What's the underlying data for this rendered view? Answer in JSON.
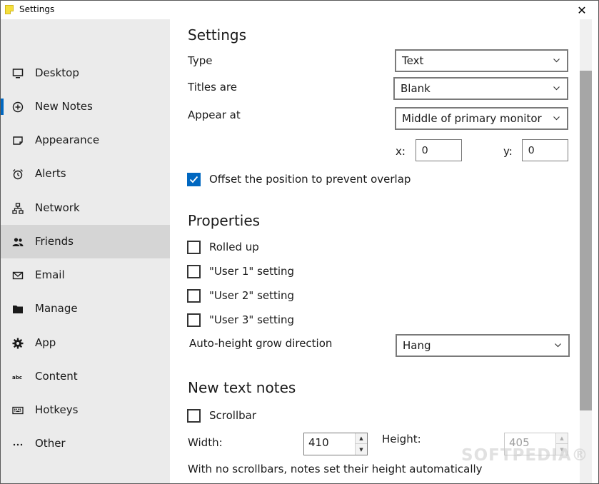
{
  "window": {
    "title": "Settings",
    "close_glyph": "✕"
  },
  "sidebar": {
    "items": [
      {
        "label": "Desktop",
        "icon": "monitor-icon"
      },
      {
        "label": "New Notes",
        "icon": "plus-circle-icon"
      },
      {
        "label": "Appearance",
        "icon": "note-icon"
      },
      {
        "label": "Alerts",
        "icon": "alarm-clock-icon"
      },
      {
        "label": "Network",
        "icon": "network-icon"
      },
      {
        "label": "Friends",
        "icon": "people-icon"
      },
      {
        "label": "Email",
        "icon": "envelope-icon"
      },
      {
        "label": "Manage",
        "icon": "folder-icon"
      },
      {
        "label": "App",
        "icon": "gear-icon"
      },
      {
        "label": "Content",
        "icon": "abc-icon"
      },
      {
        "label": "Hotkeys",
        "icon": "keyboard-icon"
      },
      {
        "label": "Other",
        "icon": "ellipsis-icon"
      }
    ],
    "selected": "Friends",
    "marked": "New Notes",
    "accent_color": "#0067c0"
  },
  "settings": {
    "heading": "Settings",
    "type_label": "Type",
    "type_value": "Text",
    "titles_label": "Titles are",
    "titles_value": "Blank",
    "appear_label": "Appear at",
    "appear_value": "Middle of primary monitor",
    "x_label": "x:",
    "x_value": "0",
    "y_label": "y:",
    "y_value": "0",
    "offset_label": "Offset the position to prevent overlap",
    "offset_checked": true
  },
  "properties": {
    "heading": "Properties",
    "checkboxes": [
      {
        "label": "Rolled up",
        "checked": false
      },
      {
        "label": "\"User 1\" setting",
        "checked": false
      },
      {
        "label": "\"User 2\" setting",
        "checked": false
      },
      {
        "label": "\"User 3\" setting",
        "checked": false
      }
    ],
    "autoheight_label": "Auto-height grow direction",
    "autoheight_value": "Hang"
  },
  "text_notes": {
    "heading": "New text notes",
    "scrollbar_label": "Scrollbar",
    "scrollbar_checked": false,
    "width_label": "Width:",
    "width_value": "410",
    "height_label": "Height:",
    "height_value": "405",
    "hint": "With no scrollbars, notes set their height automatically"
  },
  "watermark": "SOFTPEDIA®"
}
